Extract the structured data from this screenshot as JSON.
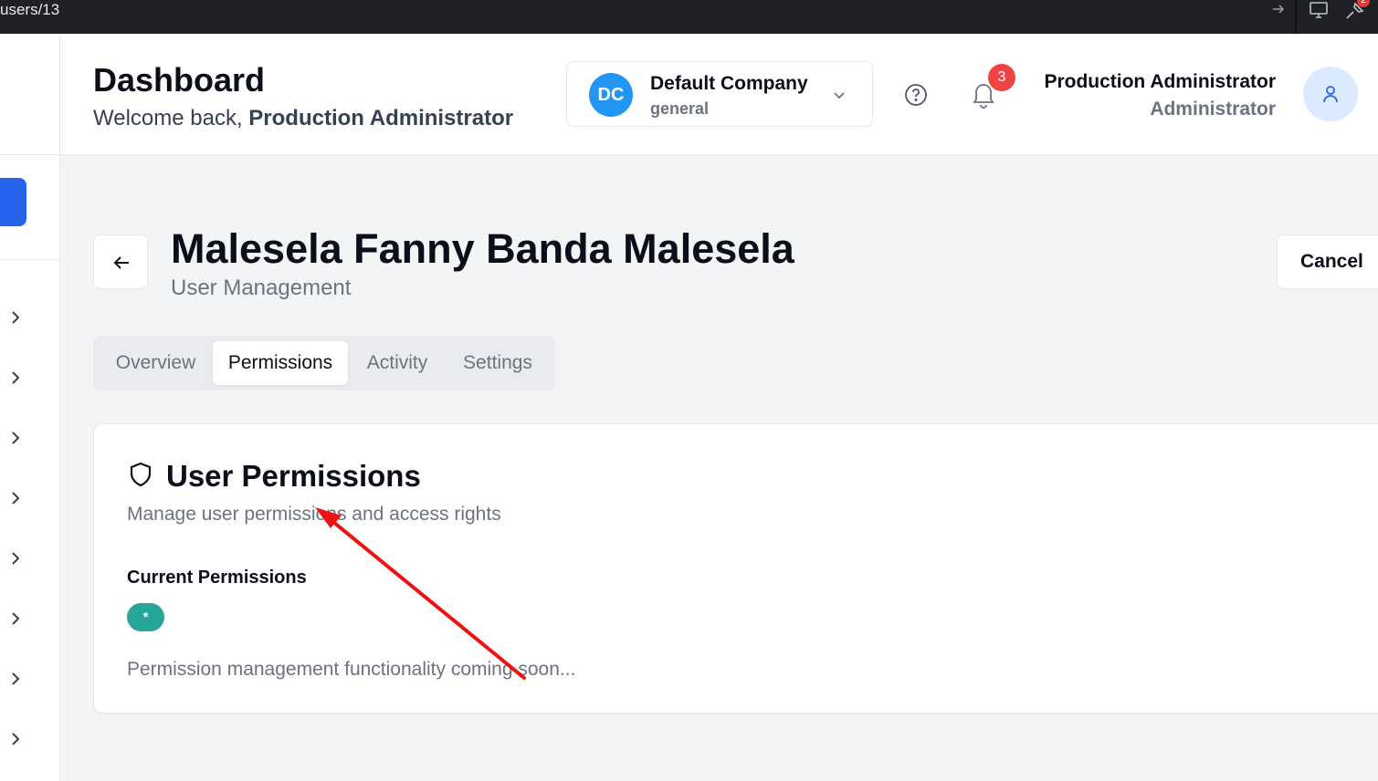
{
  "browser": {
    "url_fragment": "users/13",
    "extension_badge": "2"
  },
  "sidebar": {
    "items": [
      {
        "icon": "chevron-right-icon"
      },
      {
        "icon": "chevron-right-icon"
      },
      {
        "icon": "chevron-right-icon"
      },
      {
        "icon": "chevron-right-icon"
      },
      {
        "icon": "chevron-right-icon"
      },
      {
        "icon": "chevron-right-icon"
      },
      {
        "icon": "chevron-right-icon"
      },
      {
        "icon": "chevron-right-icon"
      }
    ],
    "active_color": "#2563eb"
  },
  "header": {
    "title": "Dashboard",
    "welcome_prefix": "Welcome back,",
    "welcome_user": "Production Administrator",
    "company": {
      "initials": "DC",
      "name": "Default Company",
      "subtitle": "general",
      "avatar_color": "#2196f3"
    },
    "notifications_count": "3",
    "user": {
      "name": "Production Administrator",
      "role": "Administrator"
    }
  },
  "page": {
    "title": "Malesela Fanny Banda Malesela",
    "subtitle": "User Management",
    "cancel_label": "Cancel"
  },
  "tabs": [
    {
      "label": "Overview",
      "active": false
    },
    {
      "label": "Permissions",
      "active": true
    },
    {
      "label": "Activity",
      "active": false
    },
    {
      "label": "Settings",
      "active": false
    }
  ],
  "permissions_card": {
    "title": "User Permissions",
    "description": "Manage user permissions and access rights",
    "current_heading": "Current Permissions",
    "badges": [
      "*"
    ],
    "badge_color": "#26a69a",
    "note": "Permission management functionality coming soon..."
  },
  "annotation": {
    "color": "#ee1111"
  }
}
